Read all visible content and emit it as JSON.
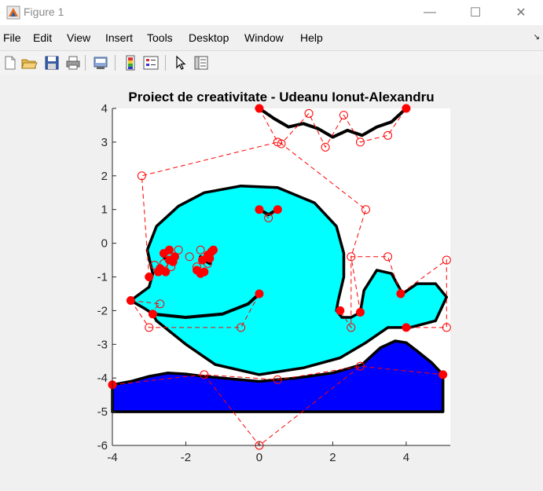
{
  "window": {
    "title": "Figure 1",
    "controls": {
      "minimize": "—",
      "maximize": "☐",
      "close": "✕"
    }
  },
  "menu": [
    "File",
    "Edit",
    "View",
    "Insert",
    "Tools",
    "Desktop",
    "Window",
    "Help"
  ],
  "toolbar": {
    "buttons": [
      "new-figure-icon",
      "open-file-icon",
      "save-icon",
      "print-icon",
      "print-preview-icon",
      "link-plot-icon",
      "insert-colorbar-icon",
      "insert-legend-icon",
      "edit-plot-arrow-icon",
      "property-inspector-icon"
    ]
  },
  "chart_data": {
    "type": "line",
    "title": "Proiect de creativitate - Udeanu Ionut-Alexandru",
    "xlabel": "",
    "ylabel": "",
    "xlim": [
      -4,
      5.2
    ],
    "ylim": [
      -6,
      4
    ],
    "xticks": [
      -4,
      -2,
      0,
      2,
      4
    ],
    "xtick_labels": [
      "-4",
      "-2",
      "0",
      "2",
      "4"
    ],
    "yticks": [
      4,
      3,
      2,
      1,
      0,
      -1,
      -2,
      -3,
      -4,
      -5,
      -6
    ],
    "ytick_labels": [
      "4",
      "3",
      "2",
      "1",
      "0",
      "-1",
      "-2",
      "-3",
      "-4",
      "-5",
      "-6"
    ],
    "grid": false,
    "colors": {
      "whale": "#00ffff",
      "water": "#0000ff",
      "curve": "#000000",
      "control": "#ff0000"
    },
    "filled_regions": [
      {
        "role": "water",
        "fill": "#0000ff",
        "points": [
          [
            -4,
            -4.2
          ],
          [
            -3.5,
            -4.1
          ],
          [
            -3,
            -3.95
          ],
          [
            -2.5,
            -3.85
          ],
          [
            -2,
            -3.88
          ],
          [
            -1.5,
            -3.95
          ],
          [
            -1,
            -4.0
          ],
          [
            0,
            -4.1
          ],
          [
            0.5,
            -4.05
          ],
          [
            1,
            -4.0
          ],
          [
            2,
            -3.85
          ],
          [
            2.8,
            -3.6
          ],
          [
            3.3,
            -3.1
          ],
          [
            3.7,
            -2.9
          ],
          [
            4,
            -2.95
          ],
          [
            4.3,
            -3.2
          ],
          [
            4.7,
            -3.55
          ],
          [
            5,
            -3.9
          ],
          [
            5,
            -5
          ],
          [
            -4,
            -5
          ]
        ]
      },
      {
        "role": "whale",
        "fill": "#00ffff",
        "points": [
          [
            -3.5,
            -1.7
          ],
          [
            -3,
            -1.3
          ],
          [
            -2.9,
            -0.9
          ],
          [
            -3.05,
            -0.2
          ],
          [
            -2.8,
            0.5
          ],
          [
            -2.2,
            1.1
          ],
          [
            -1.5,
            1.5
          ],
          [
            -0.5,
            1.7
          ],
          [
            0.5,
            1.65
          ],
          [
            1.5,
            1.2
          ],
          [
            2.1,
            0.5
          ],
          [
            2.3,
            -0.3
          ],
          [
            2.3,
            -1
          ],
          [
            2.15,
            -1.7
          ],
          [
            2.1,
            -2.0
          ],
          [
            2.25,
            -2.2
          ],
          [
            2.5,
            -2.2
          ],
          [
            2.75,
            -2.05
          ],
          [
            2.85,
            -1.4
          ],
          [
            3.2,
            -0.8
          ],
          [
            3.6,
            -0.9
          ],
          [
            3.9,
            -1.5
          ],
          [
            4.3,
            -1.2
          ],
          [
            4.8,
            -1.2
          ],
          [
            5.1,
            -1.6
          ],
          [
            4.8,
            -2.3
          ],
          [
            4.1,
            -2.5
          ],
          [
            3.5,
            -2.5
          ],
          [
            2.9,
            -2.95
          ],
          [
            2.2,
            -3.4
          ],
          [
            1.2,
            -3.7
          ],
          [
            0.0,
            -3.9
          ],
          [
            -1.2,
            -3.6
          ],
          [
            -2.0,
            -3.0
          ],
          [
            -2.8,
            -2.3
          ],
          [
            -2.9,
            -2.1
          ],
          [
            -3.1,
            -1.95
          ],
          [
            -3.5,
            -1.7
          ]
        ]
      }
    ],
    "series": [
      {
        "role": "wave-line",
        "points": [
          [
            0,
            4.0
          ],
          [
            0.4,
            3.7
          ],
          [
            0.8,
            3.45
          ],
          [
            1.2,
            3.55
          ],
          [
            1.6,
            3.4
          ],
          [
            2.0,
            3.15
          ],
          [
            2.4,
            3.35
          ],
          [
            2.8,
            3.2
          ],
          [
            3.2,
            3.45
          ],
          [
            3.6,
            3.6
          ],
          [
            4.0,
            4.0
          ]
        ]
      },
      {
        "role": "eye-top",
        "points": [
          [
            0,
            1.0
          ],
          [
            0.25,
            0.85
          ],
          [
            0.5,
            1.0
          ]
        ]
      },
      {
        "role": "mouth",
        "points": [
          [
            -2.9,
            -2.1
          ],
          [
            -2.0,
            -2.2
          ],
          [
            -1.0,
            -2.1
          ],
          [
            -0.3,
            -1.8
          ],
          [
            0,
            -1.5
          ]
        ]
      },
      {
        "role": "eye-left-1",
        "points": [
          [
            -2.6,
            -0.4
          ],
          [
            -2.45,
            -0.55
          ],
          [
            -2.3,
            -0.6
          ]
        ]
      },
      {
        "role": "eye-left-2",
        "points": [
          [
            -1.6,
            -0.4
          ],
          [
            -1.5,
            -0.5
          ],
          [
            -1.35,
            -0.6
          ]
        ]
      }
    ],
    "control_polygons": [
      {
        "points": [
          [
            0,
            4
          ],
          [
            0.5,
            3.0
          ],
          [
            0.6,
            2.95
          ],
          [
            1.35,
            3.85
          ],
          [
            1.8,
            2.85
          ],
          [
            2.3,
            3.8
          ],
          [
            2.75,
            3.0
          ],
          [
            3.5,
            3.2
          ],
          [
            4,
            4
          ]
        ]
      },
      {
        "points": [
          [
            -3,
            -1
          ],
          [
            -3.2,
            2
          ],
          [
            0.5,
            3.0
          ],
          [
            0.6,
            2.95
          ],
          [
            2.9,
            1.0
          ],
          [
            2.5,
            -0.4
          ],
          [
            2.5,
            -2.5
          ],
          [
            2.2,
            -2.0
          ]
        ]
      },
      {
        "points": [
          [
            -3.5,
            -1.7
          ],
          [
            -3,
            -2.5
          ],
          [
            -0.5,
            -2.5
          ],
          [
            0,
            -1.5
          ]
        ]
      },
      {
        "points": [
          [
            -3.5,
            -1.7
          ],
          [
            -2.7,
            -1.8
          ],
          [
            -3,
            -2.1
          ]
        ]
      },
      {
        "points": [
          [
            0,
            1
          ],
          [
            0.25,
            0.75
          ],
          [
            0.5,
            1
          ]
        ]
      },
      {
        "points": [
          [
            2.75,
            -2.05
          ],
          [
            2.5,
            -0.4
          ],
          [
            3.5,
            -0.4
          ],
          [
            3.85,
            -1.5
          ],
          [
            5.1,
            -0.5
          ],
          [
            5.1,
            -2.5
          ],
          [
            4,
            -2.5
          ]
        ]
      },
      {
        "points": [
          [
            -4,
            -4.2
          ],
          [
            -1.5,
            -3.9
          ],
          [
            0.5,
            -4.05
          ],
          [
            2.75,
            -3.65
          ],
          [
            5,
            -3.9
          ]
        ]
      },
      {
        "points": [
          [
            -1.5,
            -3.9
          ],
          [
            0,
            -6
          ],
          [
            2.75,
            -3.65
          ]
        ]
      }
    ],
    "endpoints": [
      [
        0,
        4
      ],
      [
        4,
        4
      ],
      [
        0,
        1
      ],
      [
        0.5,
        1
      ],
      [
        -3,
        -1
      ],
      [
        -3.5,
        -1.7
      ],
      [
        -2.9,
        -2.1
      ],
      [
        0,
        -1.5
      ],
      [
        2.2,
        -2.0
      ],
      [
        2.75,
        -2.05
      ],
      [
        3.85,
        -1.5
      ],
      [
        4,
        -2.5
      ],
      [
        -4,
        -4.2
      ],
      [
        5,
        -3.9
      ],
      [
        -2.6,
        -0.3
      ],
      [
        -2.45,
        -0.5
      ],
      [
        -2.35,
        -0.55
      ],
      [
        -2.7,
        -0.75
      ],
      [
        -2.55,
        -0.85
      ],
      [
        -2.45,
        -0.2
      ],
      [
        -2.3,
        -0.4
      ],
      [
        -2.75,
        -0.85
      ],
      [
        -1.55,
        -0.5
      ],
      [
        -1.4,
        -0.35
      ],
      [
        -1.3,
        -0.25
      ],
      [
        -1.7,
        -0.8
      ],
      [
        -1.6,
        -0.9
      ],
      [
        -1.5,
        -0.85
      ],
      [
        -1.35,
        -0.45
      ],
      [
        -1.25,
        -0.2
      ]
    ],
    "control_points": [
      [
        0.5,
        3.0
      ],
      [
        0.6,
        2.95
      ],
      [
        1.35,
        3.85
      ],
      [
        1.8,
        2.85
      ],
      [
        2.3,
        3.8
      ],
      [
        2.75,
        3.0
      ],
      [
        3.5,
        3.2
      ],
      [
        -3.2,
        2
      ],
      [
        2.9,
        1.0
      ],
      [
        2.5,
        -0.4
      ],
      [
        3.5,
        -0.4
      ],
      [
        5.1,
        -0.5
      ],
      [
        5.1,
        -2.5
      ],
      [
        2.5,
        -2.5
      ],
      [
        -0.5,
        -2.5
      ],
      [
        -3,
        -2.5
      ],
      [
        -2.7,
        -1.8
      ],
      [
        0.25,
        0.75
      ],
      [
        -1.5,
        -3.9
      ],
      [
        0.5,
        -4.05
      ],
      [
        2.75,
        -3.65
      ],
      [
        0,
        -6
      ],
      [
        -2.2,
        -0.2
      ],
      [
        -2.4,
        -0.7
      ],
      [
        -2.6,
        -0.6
      ],
      [
        -1.9,
        -0.4
      ],
      [
        -1.6,
        -0.2
      ],
      [
        -1.4,
        -0.6
      ],
      [
        -1.7,
        -0.7
      ],
      [
        -2.85,
        -0.65
      ]
    ]
  }
}
